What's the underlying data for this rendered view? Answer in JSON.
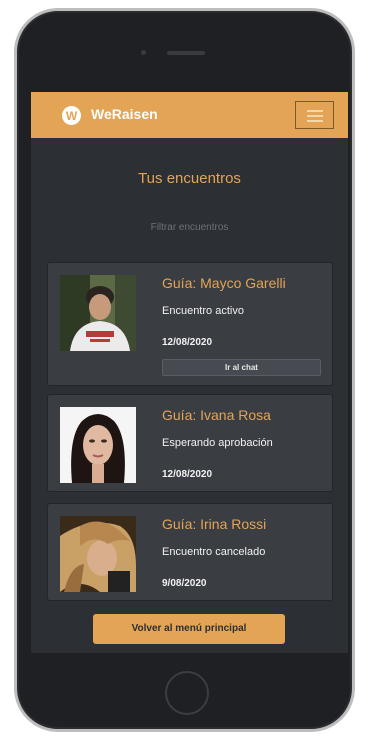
{
  "app": {
    "brand": "WeRaisen",
    "logo_letter": "W",
    "accent_color": "#e3a456"
  },
  "page": {
    "title": "Tus encuentros",
    "filter_placeholder": "Filtrar encuentros"
  },
  "encounters": [
    {
      "guide": "Guía: Mayco Garelli",
      "status": "Encuentro activo",
      "date": "12/08/2020",
      "action_label": "Ir al chat"
    },
    {
      "guide": "Guía: Ivana Rosa",
      "status": "Esperando aprobación",
      "date": "12/08/2020"
    },
    {
      "guide": "Guía: Irina Rossi",
      "status": "Encuentro cancelado",
      "date": "9/08/2020"
    }
  ],
  "footer": {
    "back_label": "Volver al menú principal"
  },
  "icons": [
    "logo-icon",
    "hamburger-menu-icon"
  ]
}
